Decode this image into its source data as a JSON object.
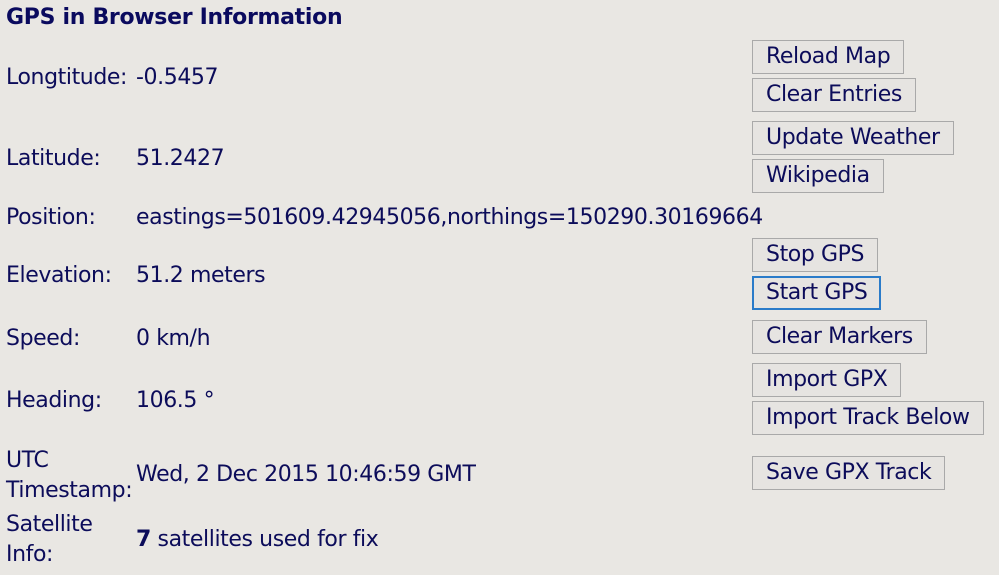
{
  "title": "GPS in Browser Information",
  "fields": {
    "longitude": {
      "label": "Longtitude:",
      "value": "-0.5457"
    },
    "latitude": {
      "label": "Latitude:",
      "value": "51.2427"
    },
    "position": {
      "label": "Position:",
      "value": "eastings=501609.42945056,northings=150290.30169664"
    },
    "elevation": {
      "label": "Elevation:",
      "value": "51.2 meters"
    },
    "speed": {
      "label": "Speed:",
      "value": "0 km/h"
    },
    "heading": {
      "label": "Heading:",
      "value": "106.5 °"
    },
    "timestamp": {
      "label_line1": "UTC",
      "label_line2": "Timestamp:",
      "value": "Wed, 2 Dec 2015 10:46:59 GMT"
    },
    "satellite": {
      "label_line1": "Satellite",
      "label_line2": "Info:",
      "count": "7",
      "value_suffix": " satellites used for fix"
    }
  },
  "buttons": {
    "reload_map": "Reload Map",
    "clear_entries": "Clear Entries",
    "update_weather": "Update Weather",
    "wikipedia": "Wikipedia",
    "stop_gps": "Stop GPS",
    "start_gps": "Start GPS",
    "clear_markers": "Clear Markers",
    "import_gpx": "Import GPX",
    "import_track_below": "Import Track Below",
    "save_gpx_track": "Save GPX Track"
  },
  "colors": {
    "text": "#0c0c5a",
    "background": "#e9e7e3",
    "focus_border": "#2a7bc9"
  }
}
